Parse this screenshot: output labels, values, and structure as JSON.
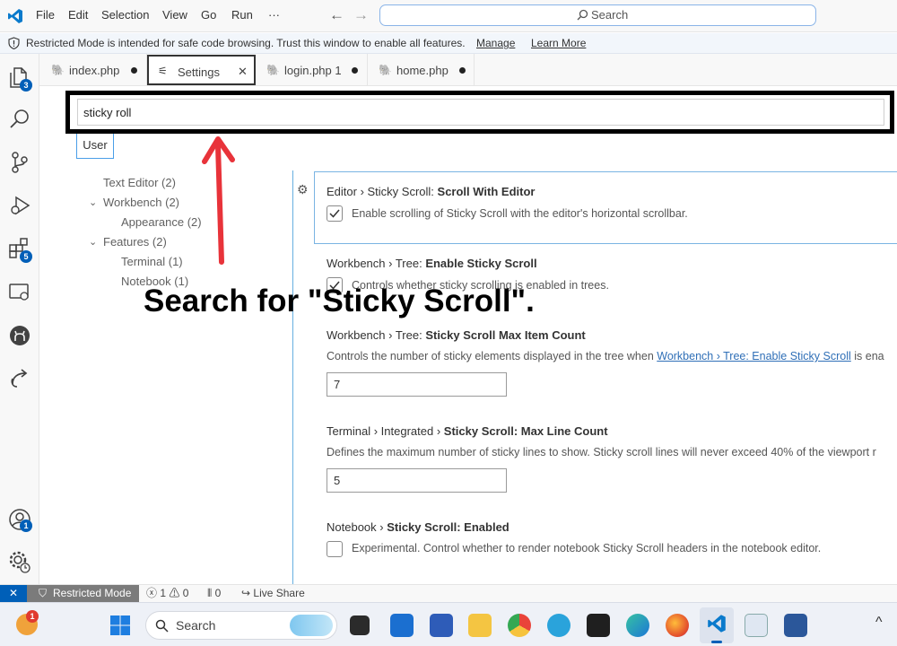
{
  "menu": {
    "items": [
      "File",
      "Edit",
      "Selection",
      "View",
      "Go",
      "Run"
    ],
    "more": "···",
    "search_label": "Search"
  },
  "banner": {
    "message": "Restricted Mode is intended for safe code browsing. Trust this window to enable all features.",
    "manage": "Manage",
    "learn_more": "Learn More"
  },
  "activity": {
    "explorer_badge": "3",
    "extensions_badge": "5",
    "accounts_badge": "1"
  },
  "tabs": [
    {
      "label": "index.php",
      "dirty": true
    },
    {
      "label": "Settings",
      "close": "✕"
    },
    {
      "label": "login.php 1",
      "dirty": true
    },
    {
      "label": "home.php",
      "dirty": true
    }
  ],
  "settings": {
    "search_value": "sticky roll",
    "scope_tab": "User",
    "tree": {
      "text_editor": "Text Editor (2)",
      "workbench": "Workbench (2)",
      "appearance": "Appearance (2)",
      "features": "Features (2)",
      "terminal": "Terminal (1)",
      "notebook": "Notebook (1)"
    },
    "entries": [
      {
        "prefix": "Editor › Sticky Scroll: ",
        "name": "Scroll With Editor",
        "desc": "Enable scrolling of Sticky Scroll with the editor's horizontal scrollbar.",
        "checked": true
      },
      {
        "prefix": "Workbench › Tree: ",
        "name": "Enable Sticky Scroll",
        "desc": "Controls whether sticky scrolling is enabled in trees.",
        "checked": true
      },
      {
        "prefix": "Workbench › Tree: ",
        "name": "Sticky Scroll Max Item Count",
        "desc": "Controls the number of sticky elements displayed in the tree when ",
        "link": "Workbench › Tree: Enable Sticky Scroll",
        "desc_after": " is ena",
        "value": "7"
      },
      {
        "prefix": "Terminal › Integrated › ",
        "name": "Sticky Scroll: Max Line Count",
        "desc": "Defines the maximum number of sticky lines to show. Sticky scroll lines will never exceed 40% of the viewport r",
        "value": "5"
      },
      {
        "prefix": "Notebook › ",
        "name": "Sticky Scroll: Enabled",
        "desc": "Experimental. Control whether to render notebook Sticky Scroll headers in the notebook editor.",
        "checked": false
      }
    ]
  },
  "annotation": "Search for \"Sticky Scroll\".",
  "statusbar": {
    "remote": "✕",
    "restricted": "Restricted Mode",
    "errors": "1",
    "warnings": "0",
    "ports": "0",
    "live_share": "Live Share"
  },
  "taskbar": {
    "search_label": "Search",
    "notification_badge": "1",
    "chevron": "^"
  },
  "colors": {
    "accent": "#005fb8",
    "annotation_arrow": "#e8333a",
    "focus_border": "#7ab4e3"
  }
}
